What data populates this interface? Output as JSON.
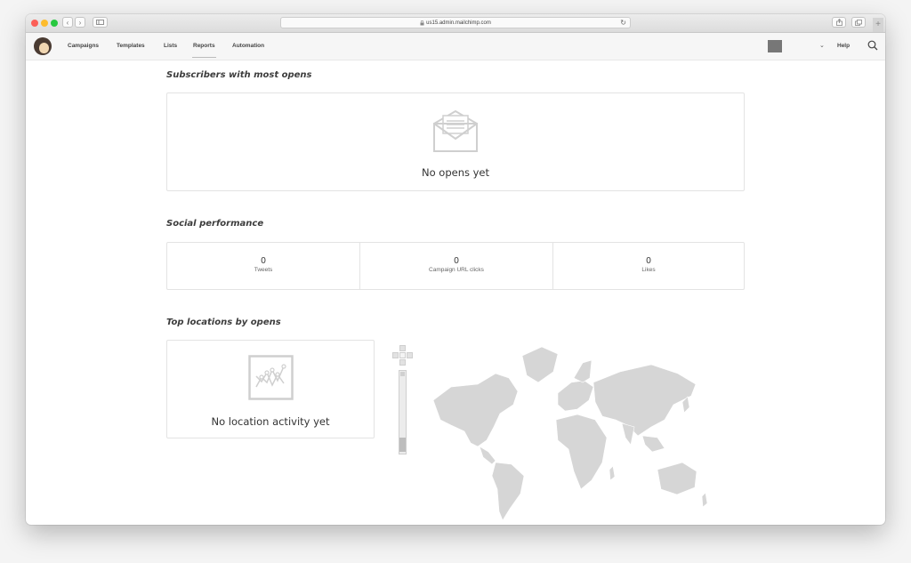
{
  "browser": {
    "url": "us15.admin.mailchimp.com",
    "lock_icon": "lock-icon"
  },
  "nav": {
    "items": [
      {
        "label": "Campaigns"
      },
      {
        "label": "Templates"
      },
      {
        "label": "Lists"
      },
      {
        "label": "Reports"
      },
      {
        "label": "Automation"
      }
    ],
    "active": "Reports",
    "help_label": "Help"
  },
  "subscribers": {
    "title": "Subscribers with most opens",
    "empty_text": "No opens yet"
  },
  "social": {
    "title": "Social performance",
    "stats": [
      {
        "value": "0",
        "label": "Tweets"
      },
      {
        "value": "0",
        "label": "Campaign URL clicks"
      },
      {
        "value": "0",
        "label": "Likes"
      }
    ]
  },
  "locations": {
    "title": "Top locations by opens",
    "empty_text": "No location activity yet"
  },
  "colors": {
    "map_land": "#d6d6d6",
    "icon_gray": "#cfcfcf"
  }
}
